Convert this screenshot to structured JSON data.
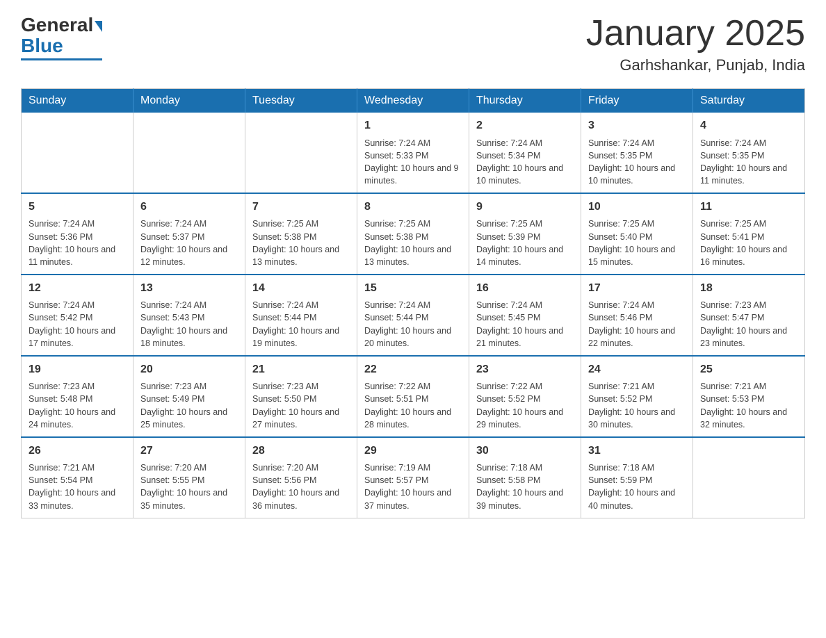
{
  "header": {
    "logo_main": "General",
    "logo_blue": "Blue",
    "title": "January 2025",
    "subtitle": "Garhshankar, Punjab, India"
  },
  "calendar": {
    "days_of_week": [
      "Sunday",
      "Monday",
      "Tuesday",
      "Wednesday",
      "Thursday",
      "Friday",
      "Saturday"
    ],
    "weeks": [
      [
        {
          "day": "",
          "info": ""
        },
        {
          "day": "",
          "info": ""
        },
        {
          "day": "",
          "info": ""
        },
        {
          "day": "1",
          "info": "Sunrise: 7:24 AM\nSunset: 5:33 PM\nDaylight: 10 hours and 9 minutes."
        },
        {
          "day": "2",
          "info": "Sunrise: 7:24 AM\nSunset: 5:34 PM\nDaylight: 10 hours and 10 minutes."
        },
        {
          "day": "3",
          "info": "Sunrise: 7:24 AM\nSunset: 5:35 PM\nDaylight: 10 hours and 10 minutes."
        },
        {
          "day": "4",
          "info": "Sunrise: 7:24 AM\nSunset: 5:35 PM\nDaylight: 10 hours and 11 minutes."
        }
      ],
      [
        {
          "day": "5",
          "info": "Sunrise: 7:24 AM\nSunset: 5:36 PM\nDaylight: 10 hours and 11 minutes."
        },
        {
          "day": "6",
          "info": "Sunrise: 7:24 AM\nSunset: 5:37 PM\nDaylight: 10 hours and 12 minutes."
        },
        {
          "day": "7",
          "info": "Sunrise: 7:25 AM\nSunset: 5:38 PM\nDaylight: 10 hours and 13 minutes."
        },
        {
          "day": "8",
          "info": "Sunrise: 7:25 AM\nSunset: 5:38 PM\nDaylight: 10 hours and 13 minutes."
        },
        {
          "day": "9",
          "info": "Sunrise: 7:25 AM\nSunset: 5:39 PM\nDaylight: 10 hours and 14 minutes."
        },
        {
          "day": "10",
          "info": "Sunrise: 7:25 AM\nSunset: 5:40 PM\nDaylight: 10 hours and 15 minutes."
        },
        {
          "day": "11",
          "info": "Sunrise: 7:25 AM\nSunset: 5:41 PM\nDaylight: 10 hours and 16 minutes."
        }
      ],
      [
        {
          "day": "12",
          "info": "Sunrise: 7:24 AM\nSunset: 5:42 PM\nDaylight: 10 hours and 17 minutes."
        },
        {
          "day": "13",
          "info": "Sunrise: 7:24 AM\nSunset: 5:43 PM\nDaylight: 10 hours and 18 minutes."
        },
        {
          "day": "14",
          "info": "Sunrise: 7:24 AM\nSunset: 5:44 PM\nDaylight: 10 hours and 19 minutes."
        },
        {
          "day": "15",
          "info": "Sunrise: 7:24 AM\nSunset: 5:44 PM\nDaylight: 10 hours and 20 minutes."
        },
        {
          "day": "16",
          "info": "Sunrise: 7:24 AM\nSunset: 5:45 PM\nDaylight: 10 hours and 21 minutes."
        },
        {
          "day": "17",
          "info": "Sunrise: 7:24 AM\nSunset: 5:46 PM\nDaylight: 10 hours and 22 minutes."
        },
        {
          "day": "18",
          "info": "Sunrise: 7:23 AM\nSunset: 5:47 PM\nDaylight: 10 hours and 23 minutes."
        }
      ],
      [
        {
          "day": "19",
          "info": "Sunrise: 7:23 AM\nSunset: 5:48 PM\nDaylight: 10 hours and 24 minutes."
        },
        {
          "day": "20",
          "info": "Sunrise: 7:23 AM\nSunset: 5:49 PM\nDaylight: 10 hours and 25 minutes."
        },
        {
          "day": "21",
          "info": "Sunrise: 7:23 AM\nSunset: 5:50 PM\nDaylight: 10 hours and 27 minutes."
        },
        {
          "day": "22",
          "info": "Sunrise: 7:22 AM\nSunset: 5:51 PM\nDaylight: 10 hours and 28 minutes."
        },
        {
          "day": "23",
          "info": "Sunrise: 7:22 AM\nSunset: 5:52 PM\nDaylight: 10 hours and 29 minutes."
        },
        {
          "day": "24",
          "info": "Sunrise: 7:21 AM\nSunset: 5:52 PM\nDaylight: 10 hours and 30 minutes."
        },
        {
          "day": "25",
          "info": "Sunrise: 7:21 AM\nSunset: 5:53 PM\nDaylight: 10 hours and 32 minutes."
        }
      ],
      [
        {
          "day": "26",
          "info": "Sunrise: 7:21 AM\nSunset: 5:54 PM\nDaylight: 10 hours and 33 minutes."
        },
        {
          "day": "27",
          "info": "Sunrise: 7:20 AM\nSunset: 5:55 PM\nDaylight: 10 hours and 35 minutes."
        },
        {
          "day": "28",
          "info": "Sunrise: 7:20 AM\nSunset: 5:56 PM\nDaylight: 10 hours and 36 minutes."
        },
        {
          "day": "29",
          "info": "Sunrise: 7:19 AM\nSunset: 5:57 PM\nDaylight: 10 hours and 37 minutes."
        },
        {
          "day": "30",
          "info": "Sunrise: 7:18 AM\nSunset: 5:58 PM\nDaylight: 10 hours and 39 minutes."
        },
        {
          "day": "31",
          "info": "Sunrise: 7:18 AM\nSunset: 5:59 PM\nDaylight: 10 hours and 40 minutes."
        },
        {
          "day": "",
          "info": ""
        }
      ]
    ]
  }
}
